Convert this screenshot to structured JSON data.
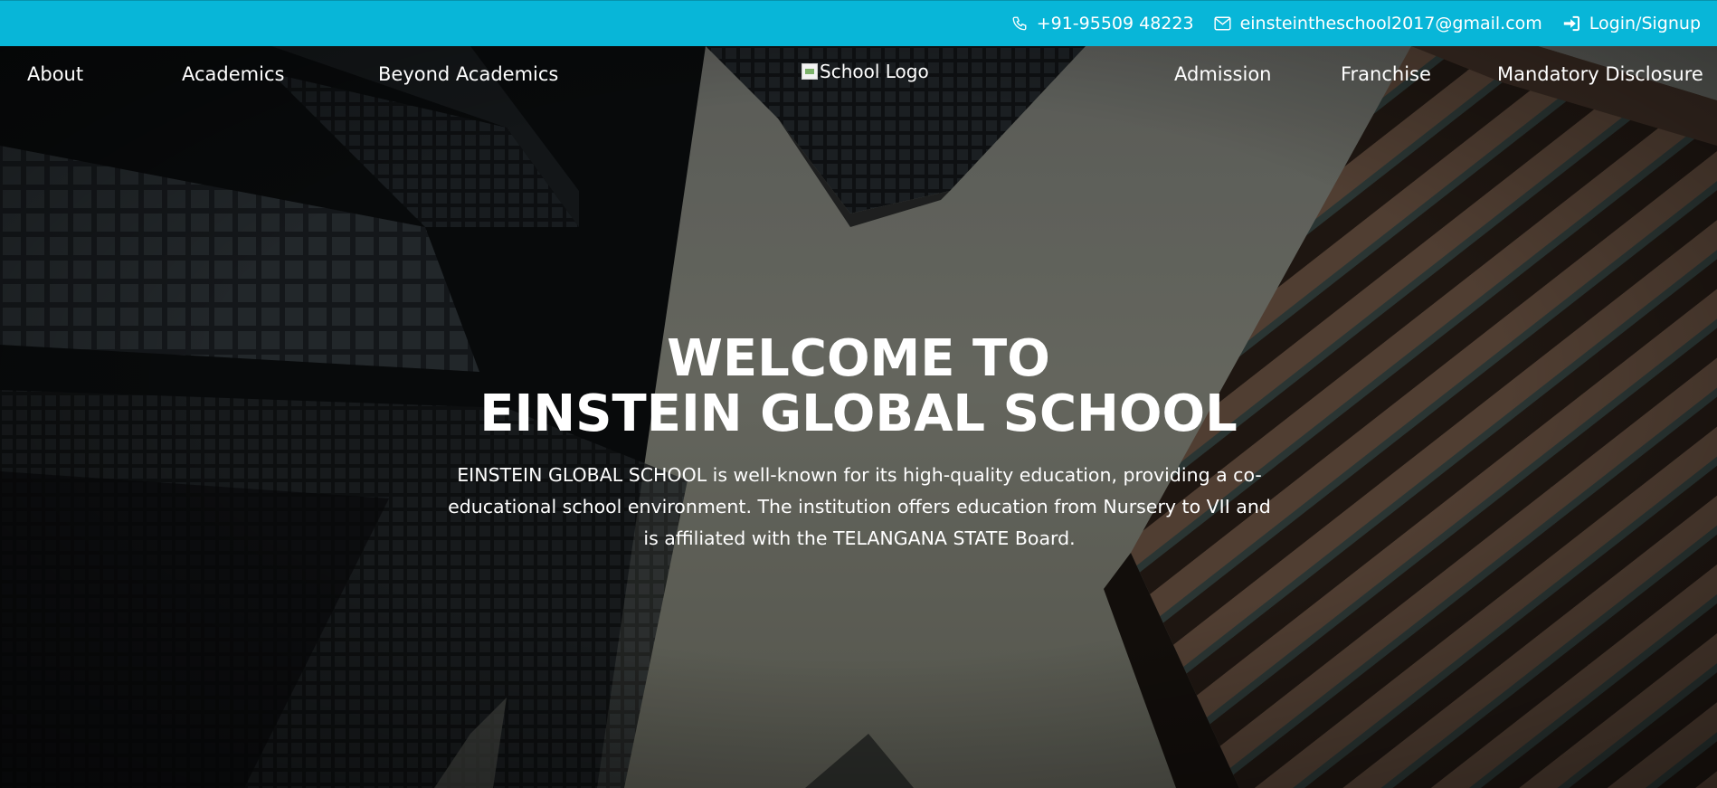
{
  "topbar": {
    "background": "#08b6d8",
    "phone": {
      "icon": "phone-icon",
      "text": "+91-95509 48223"
    },
    "email": {
      "icon": "envelope-icon",
      "text": "einsteintheschool2017@gmail.com"
    },
    "login": {
      "icon": "sign-in-icon",
      "text": "Login/Signup"
    }
  },
  "nav": {
    "left": [
      "About",
      "Academics",
      "Beyond Academics"
    ],
    "logo_alt": "School Logo",
    "right": [
      "Admission",
      "Franchise",
      "Mandatory Disclosure"
    ]
  },
  "hero": {
    "title_line1": "WELCOME TO",
    "title_line2": "EINSTEIN GLOBAL SCHOOL",
    "description": "EINSTEIN GLOBAL SCHOOL is well-known for its high-quality education, providing a co-educational school environment. The institution offers education from Nursery to VII and is affiliated with the TELANGANA STATE Board."
  }
}
